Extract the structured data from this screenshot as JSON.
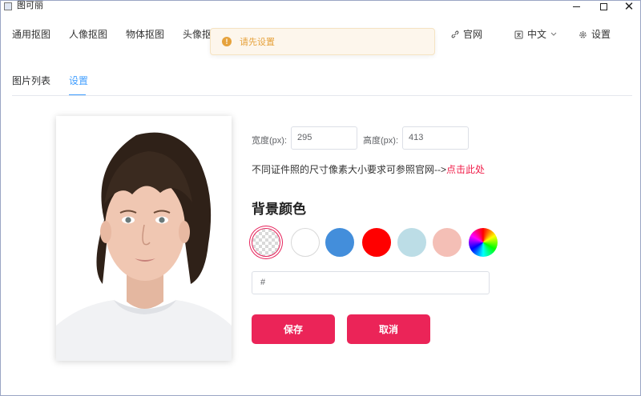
{
  "window": {
    "title": "图可丽",
    "close_glyph": "✕"
  },
  "nav": {
    "items": [
      "通用抠图",
      "人像抠图",
      "物体抠图",
      "头像抠"
    ],
    "official_site": "官网",
    "language": "中文",
    "settings": "设置"
  },
  "toast": {
    "icon": "warning-icon",
    "text": "请先设置"
  },
  "tabs": {
    "list": "图片列表",
    "settings": "设置",
    "active": "settings"
  },
  "form": {
    "width_label": "宽度(px):",
    "width_value": "295",
    "height_label": "高度(px):",
    "height_value": "413",
    "hint_text": "不同证件照的尺寸像素大小要求可参照官网-->",
    "hint_link": "点击此处",
    "bg_title": "背景颜色",
    "swatches": [
      {
        "name": "transparent",
        "color": "transparent"
      },
      {
        "name": "white",
        "color": "#ffffff"
      },
      {
        "name": "blue",
        "color": "#438edb"
      },
      {
        "name": "red",
        "color": "#ff0000"
      },
      {
        "name": "light-blue",
        "color": "#bcdde6"
      },
      {
        "name": "pink",
        "color": "#f4bfb6"
      },
      {
        "name": "color-wheel",
        "color": "rainbow"
      }
    ],
    "selected_swatch": "transparent",
    "color_value": "#",
    "save_label": "保存",
    "cancel_label": "取消"
  },
  "colors": {
    "accent": "#eb2458",
    "tab_active": "#409eff",
    "warning": "#e6a23c",
    "link": "#f01e4a"
  }
}
